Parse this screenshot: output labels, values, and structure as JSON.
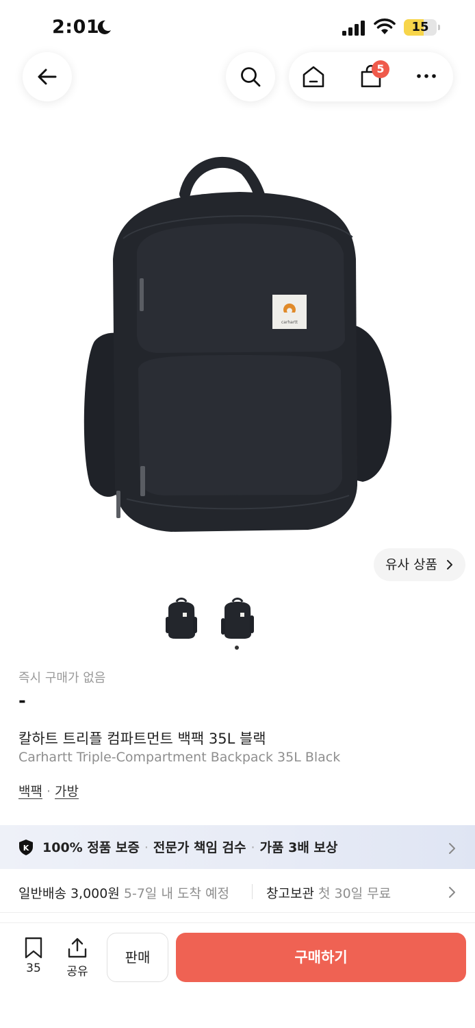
{
  "status_bar": {
    "time": "2:01",
    "battery_level": "15",
    "battery_fraction": 0.15
  },
  "nav": {
    "cart_count": "5",
    "icons": [
      "back-arrow-icon",
      "search-icon",
      "home-icon",
      "shopping-bag-icon",
      "more-icon"
    ]
  },
  "product": {
    "similar_label": "유사 상품",
    "image_count": 2,
    "selected_image": 2,
    "instant_label": "즉시 구매가 없음",
    "price": "-",
    "title_ko": "칼하트 트리플 컴파트먼트 백팩 35L 블랙",
    "title_en": "Carhartt Triple-Compartment Backpack 35L Black",
    "category_1": "백팩",
    "category_sep": "·",
    "category_2": "가방",
    "patch_text": "carhartt"
  },
  "guarantee": {
    "item_1": "100% 정품 보증",
    "item_2": "전문가 책임 검수",
    "item_3": "가품 3배 보상",
    "separator": "·",
    "badge_letter": "K"
  },
  "shipping": {
    "label": "일반배송 3,000원",
    "eta": "5-7일 내 도착 예정",
    "storage_label": "창고보관",
    "storage_note": "첫 30일 무료"
  },
  "actions": {
    "bookmark_count": "35",
    "share_label": "공유",
    "sell_label": "판매",
    "buy_label": "구매하기"
  },
  "colors": {
    "accent": "#ef6253",
    "badge": "#ef5a4b",
    "battery": "#f7d54a",
    "banner": "#e7ebf6"
  }
}
